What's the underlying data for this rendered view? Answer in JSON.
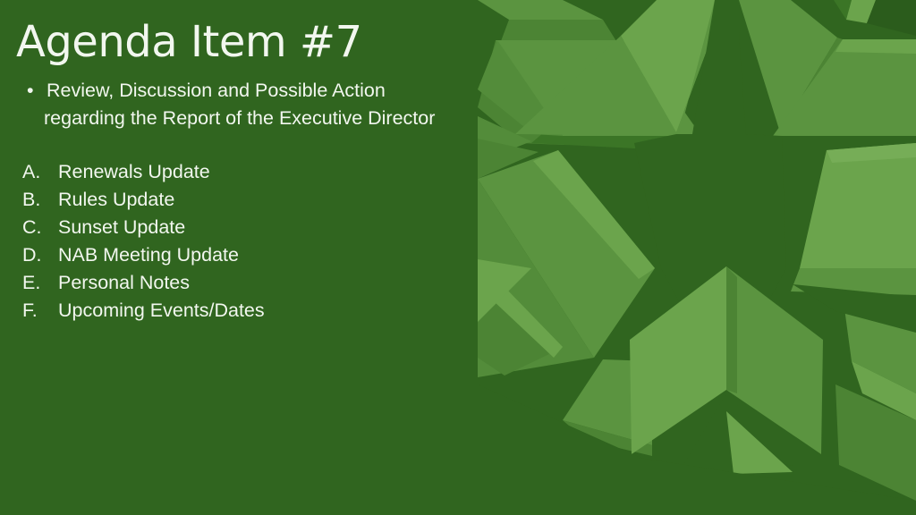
{
  "slide": {
    "title": "Agenda Item #7",
    "background_color": "#30651f",
    "text_color": "#f2f7ef"
  },
  "intro": {
    "bullet_glyph": "•",
    "line1": "Review, Discussion and Possible Action",
    "line2": "regarding the Report of the Executive Director"
  },
  "agenda_items": [
    {
      "marker": "A.",
      "label": "Renewals Update"
    },
    {
      "marker": "B.",
      "label": "Rules Update"
    },
    {
      "marker": "C.",
      "label": "Sunset Update"
    },
    {
      "marker": "D.",
      "label": "NAB Meeting Update"
    },
    {
      "marker": "E.",
      "label": "Personal Notes"
    },
    {
      "marker": "F.",
      "label": "Upcoming Events/Dates"
    }
  ],
  "decoration": {
    "name": "faceted-star-burst",
    "palette": {
      "base": "#30651f",
      "shade_dark": "#2b5c1c",
      "shade_mid": "#3b7526",
      "facet_light": "#5b9440",
      "facet_lighter": "#6ba44c",
      "facet_pale": "#76ad57",
      "facet_deep": "#4c8434"
    }
  }
}
